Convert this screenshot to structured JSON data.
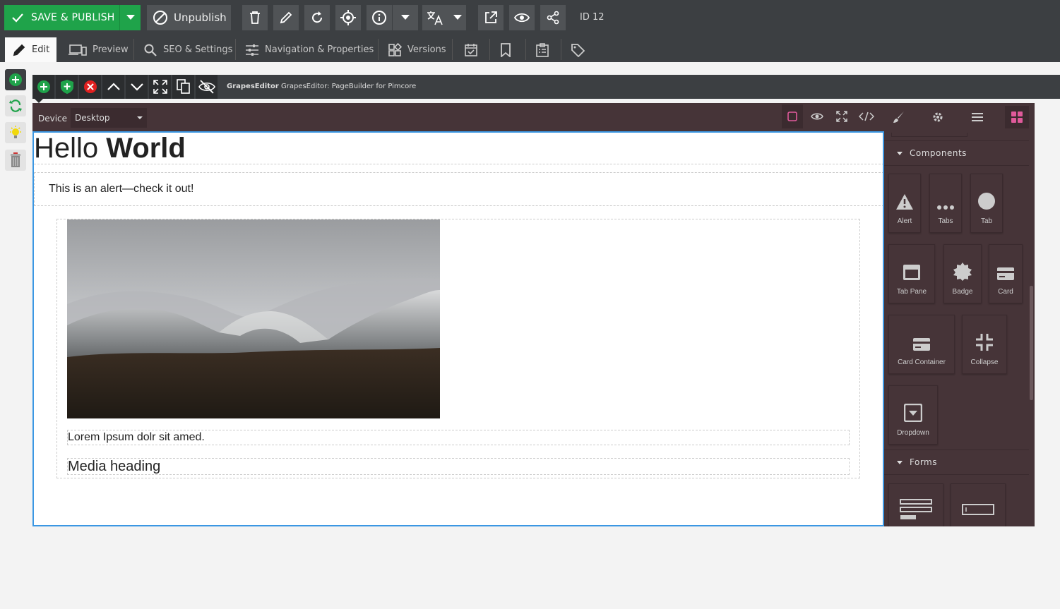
{
  "toolbar": {
    "save_publish": "SAVE & PUBLISH",
    "unpublish": "Unpublish",
    "id_label": "ID 12",
    "accent": "#1fa34a"
  },
  "tabs": [
    {
      "label": "Edit",
      "icon": "pencil-icon"
    },
    {
      "label": "Preview",
      "icon": "devices-icon"
    },
    {
      "label": "SEO & Settings",
      "icon": "search-icon"
    },
    {
      "label": "Navigation & Properties",
      "icon": "sliders-icon"
    },
    {
      "label": "Versions",
      "icon": "versions-icon"
    }
  ],
  "editor": {
    "title_bold": "GrapesEditor",
    "title_rest": "GrapesEditor: PageBuilder for Pimcore",
    "device_label": "Device",
    "device_value": "Desktop"
  },
  "canvas": {
    "heading_light": "Hello ",
    "heading_bold": "World",
    "alert_text": "This is an alert—check it out!",
    "lorem": "Lorem Ipsum dolr sit amed.",
    "media_heading": "Media heading"
  },
  "panel": {
    "categories": [
      "Components",
      "Forms"
    ],
    "blocks": [
      "Alert",
      "Tabs",
      "Tab",
      "Tab Pane",
      "Badge",
      "Card",
      "Card Container",
      "Collapse",
      "Dropdown"
    ]
  }
}
